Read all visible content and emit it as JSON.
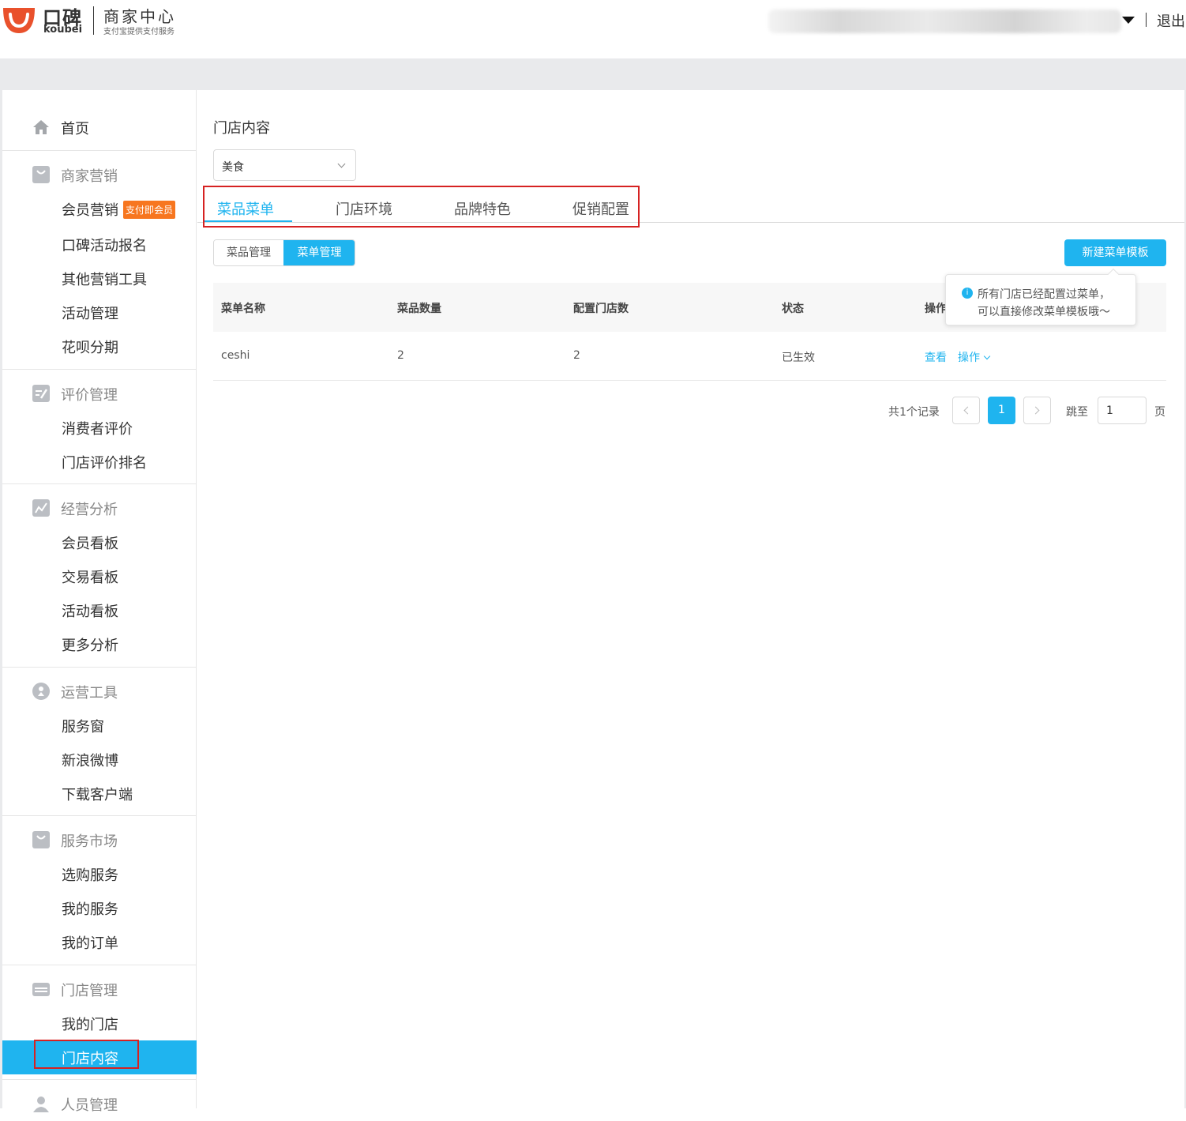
{
  "brand": {
    "name_cn": "口碑",
    "name_en": "koubei",
    "title": "商家中心",
    "subtitle": "支付宝提供支付服务"
  },
  "header": {
    "logout": "退出"
  },
  "sidebar": {
    "items": [
      {
        "label": "首页",
        "kind": "top",
        "icon": "home-icon"
      },
      {
        "label": "商家营销",
        "kind": "group",
        "icon": "shopping-bag-icon"
      },
      {
        "label": "会员营销",
        "kind": "sub",
        "badge": "支付即会员"
      },
      {
        "label": "口碑活动报名",
        "kind": "sub"
      },
      {
        "label": "其他营销工具",
        "kind": "sub"
      },
      {
        "label": "活动管理",
        "kind": "sub"
      },
      {
        "label": "花呗分期",
        "kind": "sub"
      },
      {
        "label": "评价管理",
        "kind": "group",
        "icon": "edit-icon"
      },
      {
        "label": "消费者评价",
        "kind": "sub"
      },
      {
        "label": "门店评价排名",
        "kind": "sub"
      },
      {
        "label": "经营分析",
        "kind": "group",
        "icon": "chart-icon"
      },
      {
        "label": "会员看板",
        "kind": "sub"
      },
      {
        "label": "交易看板",
        "kind": "sub"
      },
      {
        "label": "活动看板",
        "kind": "sub"
      },
      {
        "label": "更多分析",
        "kind": "sub"
      },
      {
        "label": "运营工具",
        "kind": "group",
        "icon": "medal-icon"
      },
      {
        "label": "服务窗",
        "kind": "sub"
      },
      {
        "label": "新浪微博",
        "kind": "sub"
      },
      {
        "label": "下载客户端",
        "kind": "sub"
      },
      {
        "label": "服务市场",
        "kind": "group",
        "icon": "shopping-bag-icon"
      },
      {
        "label": "选购服务",
        "kind": "sub"
      },
      {
        "label": "我的服务",
        "kind": "sub"
      },
      {
        "label": "我的订单",
        "kind": "sub"
      },
      {
        "label": "门店管理",
        "kind": "group",
        "icon": "store-icon"
      },
      {
        "label": "我的门店",
        "kind": "sub"
      },
      {
        "label": "门店内容",
        "kind": "sub",
        "active": true
      },
      {
        "label": "人员管理",
        "kind": "group",
        "icon": "person-icon"
      }
    ]
  },
  "main": {
    "page_title": "门店内容",
    "category_select": {
      "value": "美食"
    },
    "tabs": [
      {
        "label": "菜品菜单",
        "active": true
      },
      {
        "label": "门店环境"
      },
      {
        "label": "品牌特色"
      },
      {
        "label": "促销配置"
      }
    ],
    "segments": [
      {
        "label": "菜品管理",
        "active": false
      },
      {
        "label": "菜单管理",
        "active": true
      }
    ],
    "new_template_button": "新建菜单模板",
    "tooltip": {
      "line1": "所有门店已经配置过菜单，",
      "line2": "可以直接修改菜单模板哦～"
    },
    "table": {
      "columns": [
        "菜单名称",
        "菜品数量",
        "配置门店数",
        "状态",
        "操作"
      ],
      "rows": [
        {
          "name": "ceshi",
          "dish_count": "2",
          "store_count": "2",
          "status": "已生效",
          "view": "查看",
          "action": "操作"
        }
      ]
    },
    "pagination": {
      "total": "共1个记录",
      "current": "1",
      "jump_label": "跳至",
      "jump_value": "1",
      "page_unit": "页"
    }
  },
  "colors": {
    "accent": "#1fb4ef",
    "badge": "#f7761f",
    "highlight_border": "#d62222"
  }
}
